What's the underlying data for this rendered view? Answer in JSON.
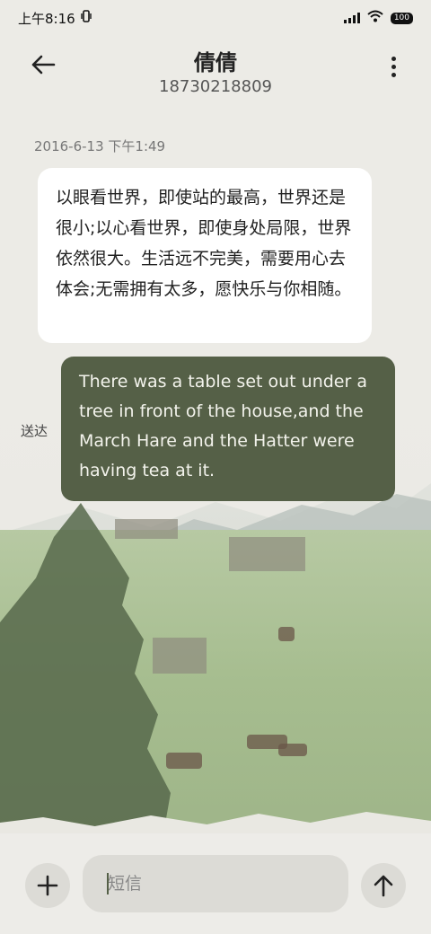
{
  "status_bar": {
    "time": "上午8:16",
    "battery": "100",
    "icons": [
      "vibrate-icon",
      "signal-icon",
      "wifi-icon",
      "battery-icon"
    ]
  },
  "header": {
    "contact_name": "倩倩",
    "phone_number": "18730218809",
    "back_icon": "arrow-left-icon",
    "more_icon": "more-vertical-icon"
  },
  "conversation": {
    "timestamp": "2016-6-13 下午1:49",
    "incoming_message": "以眼看世界，即使站的最高，世界还是很小;以心看世界，即使身处局限，世界依然很大。生活远不完美，需要用心去体会;无需拥有太多，愿快乐与你相随。",
    "outgoing_message": "There was a table set out under a tree in front of the house,and the March Hare and the Hatter were having tea at it.",
    "outgoing_status": "送达"
  },
  "composer": {
    "placeholder": "短信",
    "add_icon": "plus-icon",
    "send_icon": "arrow-up-icon"
  },
  "colors": {
    "outgoing_bubble": "#556047",
    "incoming_bubble": "#ffffff",
    "background": "#ecebe6"
  }
}
